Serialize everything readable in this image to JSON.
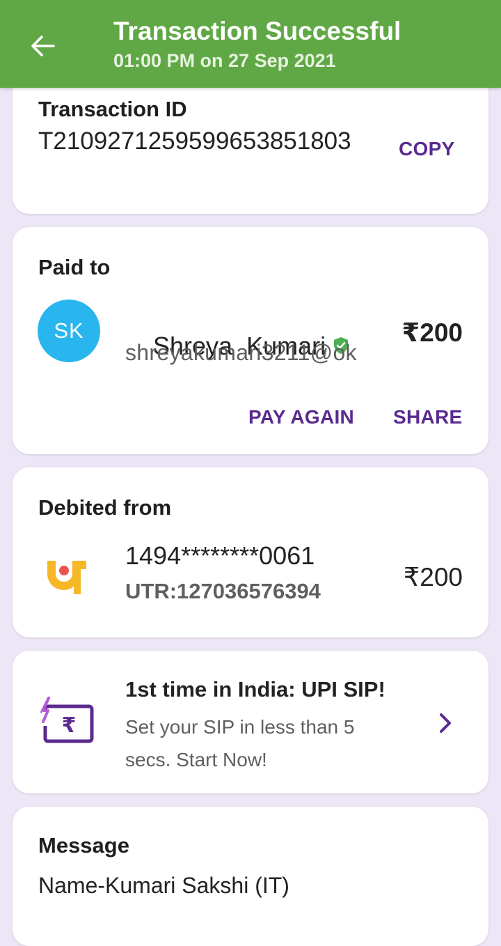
{
  "header": {
    "title": "Transaction Successful",
    "subtitle": "01:00 PM on 27 Sep 2021",
    "background_color": "#5fa845"
  },
  "transaction": {
    "label": "Transaction ID",
    "id": "T2109271259599653851803",
    "copy_label": "COPY"
  },
  "paid_to": {
    "label": "Paid to",
    "avatar_initials": "SK",
    "avatar_color": "#29b5ee",
    "name": "Shreya  Kumari",
    "verified_icon": "verified-shield-icon",
    "upi_id": "shreyakumari3211@ok",
    "amount": "₹200",
    "pay_again_label": "PAY AGAIN",
    "share_label": "SHARE"
  },
  "debited_from": {
    "label": "Debited from",
    "bank_icon": "bank-logo-icon",
    "account": "1494********0061",
    "utr": "UTR:127036576394",
    "amount": "₹200"
  },
  "promo": {
    "icon": "upi-sip-icon",
    "title": "1st time in India: UPI SIP!",
    "description": "Set your SIP in less than 5 secs. Start Now!"
  },
  "message": {
    "label": "Message",
    "text": "Name-Kumari Sakshi (IT)"
  },
  "colors": {
    "accent_purple": "#5a2a8f",
    "page_background": "#ede6f6"
  }
}
